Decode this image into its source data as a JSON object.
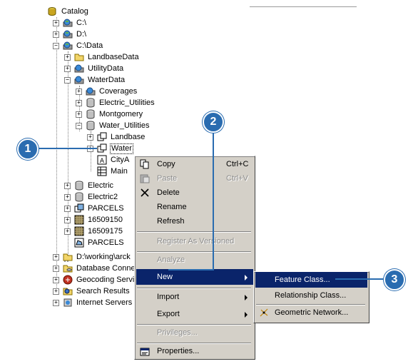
{
  "tree": {
    "catalog": "Catalog",
    "c_drive": "C:\\",
    "d_drive": "D:\\",
    "c_data": "C:\\Data",
    "landbase_data": "LandbaseData",
    "utility_data": "UtilityData",
    "water_data": "WaterData",
    "coverages": "Coverages",
    "electric_utilities": "Electric_Utilities",
    "montgomery": "Montgomery",
    "water_utilities": "Water_Utilities",
    "landbase": "Landbase",
    "water": "Water",
    "citya": "CityA",
    "main": "Main",
    "electric": "Electric",
    "electric2": "Electric2",
    "parcels": "PARCELS",
    "n16509150": "16509150",
    "n16509175": "16509175",
    "parcels2": "PARCELS",
    "d_working": "D:\\working\\arck",
    "database_conn": "Database Conne",
    "geocoding": "Geocoding Servi",
    "search_results": "Search Results",
    "internet_servers": "Internet Servers"
  },
  "context_menu": {
    "copy": "Copy",
    "copy_shortcut": "Ctrl+C",
    "paste": "Paste",
    "paste_shortcut": "Ctrl+V",
    "delete": "Delete",
    "rename": "Rename",
    "refresh": "Refresh",
    "register_versioned": "Register As Versioned",
    "analyze": "Analyze",
    "new": "New",
    "import": "Import",
    "export": "Export",
    "privileges": "Privileges...",
    "properties": "Properties..."
  },
  "submenu": {
    "feature_class": "Feature Class...",
    "relationship_class": "Relationship Class...",
    "geometric_network": "Geometric Network..."
  },
  "callouts": {
    "one": "1",
    "two": "2",
    "three": "3"
  },
  "colors": {
    "highlight": "#0a246a",
    "callout": "#2a6cb0",
    "menu_bg": "#d4d0c8"
  }
}
